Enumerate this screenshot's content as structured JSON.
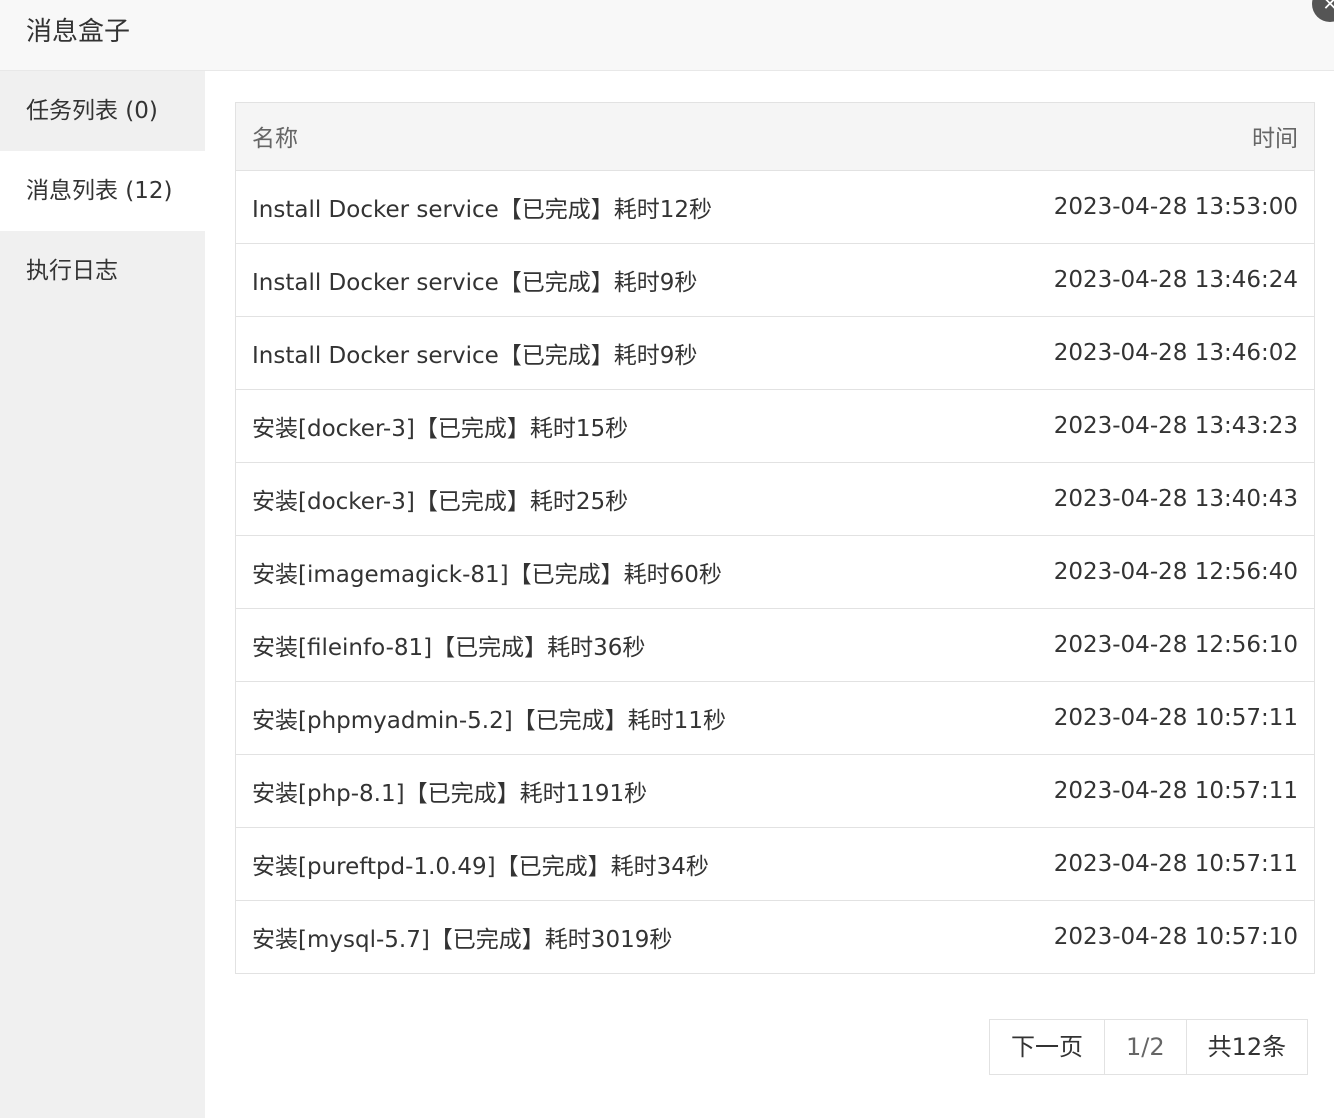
{
  "window": {
    "title": "消息盒子",
    "close_symbol": "✕"
  },
  "sidebar": {
    "items": [
      {
        "label": "任务列表 (0)",
        "active": false
      },
      {
        "label": "消息列表 (12)",
        "active": true
      },
      {
        "label": "执行日志",
        "active": false
      }
    ]
  },
  "table": {
    "headers": {
      "name": "名称",
      "time": "时间"
    },
    "rows": [
      {
        "name": "Install Docker service【已完成】耗时12秒",
        "time": "2023-04-28 13:53:00"
      },
      {
        "name": "Install Docker service【已完成】耗时9秒",
        "time": "2023-04-28 13:46:24"
      },
      {
        "name": "Install Docker service【已完成】耗时9秒",
        "time": "2023-04-28 13:46:02"
      },
      {
        "name": "安装[docker-3]【已完成】耗时15秒",
        "time": "2023-04-28 13:43:23"
      },
      {
        "name": "安装[docker-3]【已完成】耗时25秒",
        "time": "2023-04-28 13:40:43"
      },
      {
        "name": "安装[imagemagick-81]【已完成】耗时60秒",
        "time": "2023-04-28 12:56:40"
      },
      {
        "name": "安装[fileinfo-81]【已完成】耗时36秒",
        "time": "2023-04-28 12:56:10"
      },
      {
        "name": "安装[phpmyadmin-5.2]【已完成】耗时11秒",
        "time": "2023-04-28 10:57:11"
      },
      {
        "name": "安装[php-8.1]【已完成】耗时1191秒",
        "time": "2023-04-28 10:57:11"
      },
      {
        "name": "安装[pureftpd-1.0.49]【已完成】耗时34秒",
        "time": "2023-04-28 10:57:11"
      },
      {
        "name": "安装[mysql-5.7]【已完成】耗时3019秒",
        "time": "2023-04-28 10:57:10"
      }
    ]
  },
  "pagination": {
    "next_label": "下一页",
    "page": "1/2",
    "total": "共12条"
  }
}
